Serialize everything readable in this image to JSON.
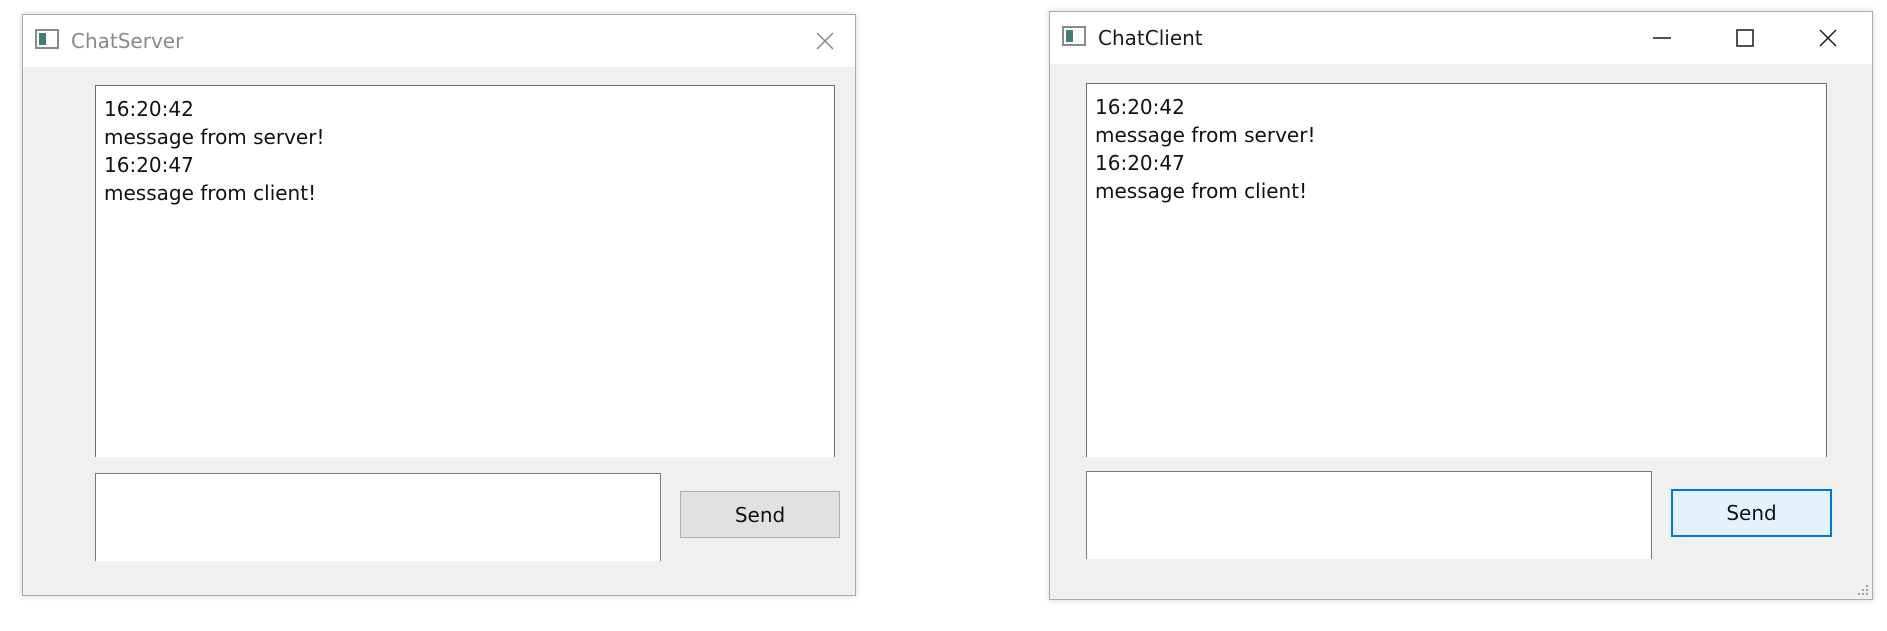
{
  "server_window": {
    "title": "ChatServer",
    "icon": "app-window-icon",
    "title_color": "#8a8a8a",
    "chat_log": [
      "16:20:42",
      "message from server!",
      "16:20:47",
      "message from client!"
    ],
    "input_value": "",
    "send_label": "Send",
    "controls": [
      "close-icon"
    ]
  },
  "client_window": {
    "title": "ChatClient",
    "icon": "app-window-icon",
    "title_color": "#1a1a1a",
    "chat_log": [
      "16:20:42",
      "message from server!",
      "16:20:47",
      "message from client!"
    ],
    "input_value": "",
    "send_label": "Send",
    "send_focus_color": "#0078d7",
    "controls": [
      "minimize-icon",
      "maximize-icon",
      "close-icon"
    ]
  }
}
